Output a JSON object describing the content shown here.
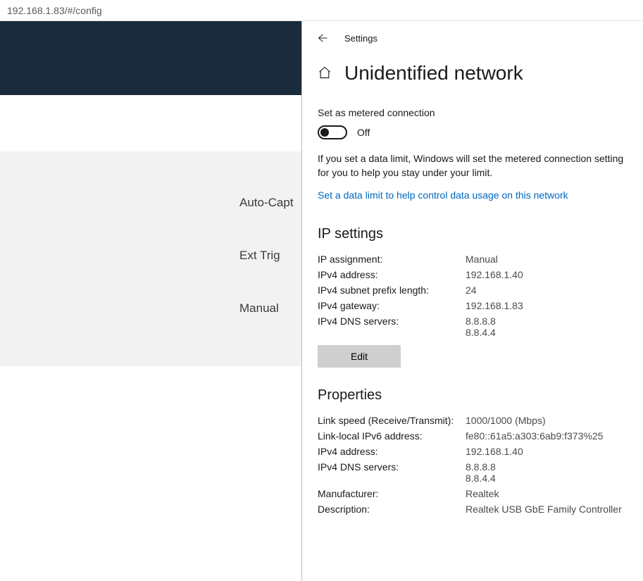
{
  "address_bar": "192.168.1.83/#/config",
  "background": {
    "rows": [
      "Auto-Capt",
      "Ext Trig",
      "Manual"
    ]
  },
  "settings": {
    "top_label": "Settings",
    "title": "Unidentified network",
    "metered": {
      "heading": "Set as metered connection",
      "toggle_label": "Off",
      "description": "If you set a data limit, Windows will set the metered connection setting for you to help you stay under your limit.",
      "link": "Set a data limit to help control data usage on this network"
    },
    "ip_settings": {
      "heading": "IP settings",
      "rows": [
        {
          "label": "IP assignment:",
          "value": "Manual"
        },
        {
          "label": "IPv4 address:",
          "value": "192.168.1.40"
        },
        {
          "label": "IPv4 subnet prefix length:",
          "value": "24"
        },
        {
          "label": "IPv4 gateway:",
          "value": "192.168.1.83"
        },
        {
          "label": "IPv4 DNS servers:",
          "value": "8.8.8.8\n8.8.4.4"
        }
      ],
      "edit_label": "Edit"
    },
    "properties": {
      "heading": "Properties",
      "rows": [
        {
          "label": "Link speed (Receive/Transmit):",
          "value": "1000/1000 (Mbps)"
        },
        {
          "label": "Link-local IPv6 address:",
          "value": "fe80::61a5:a303:6ab9:f373%25"
        },
        {
          "label": "IPv4 address:",
          "value": "192.168.1.40"
        },
        {
          "label": "IPv4 DNS servers:",
          "value": "8.8.8.8\n8.8.4.4"
        },
        {
          "label": "Manufacturer:",
          "value": "Realtek"
        },
        {
          "label": "Description:",
          "value": "Realtek USB GbE Family Controller"
        }
      ]
    }
  }
}
